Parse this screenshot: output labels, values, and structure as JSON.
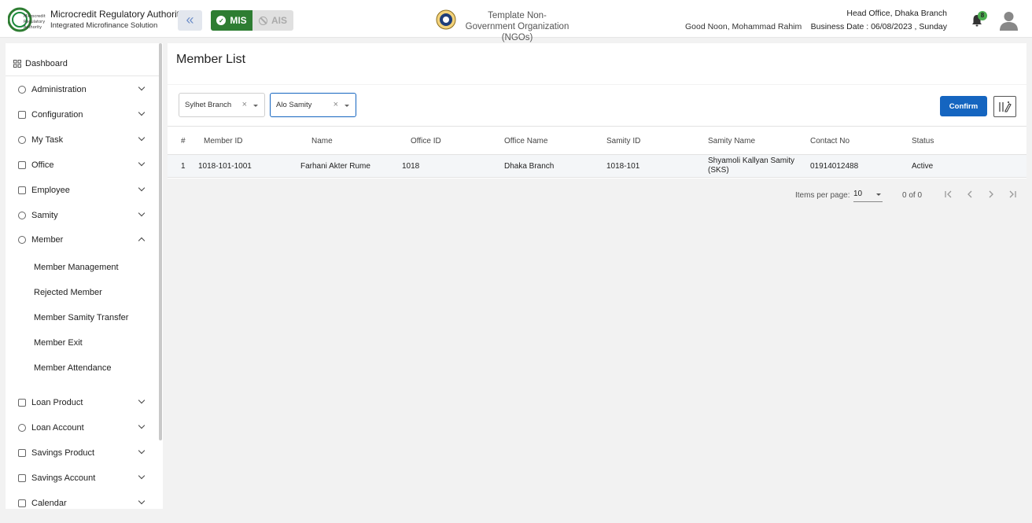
{
  "header": {
    "logo_text": "Microcredit Regulatory Authority",
    "org_name": "Microcredit Regulatory Authority",
    "org_subtitle": "Integrated Microfinance Solution",
    "mis_label": "MIS",
    "ais_label": "AIS",
    "ngo_title": "Template Non-Government Organization (NGOs)",
    "greeting": "Good Noon, Mohammad Rahim",
    "office": "Head Office, Dhaka Branch",
    "business_date": "Business Date : 06/08/2023 , Sunday",
    "notification_count": "8",
    "accent": "#2e7d32"
  },
  "sidebar": {
    "dashboard": "Dashboard",
    "items": [
      {
        "label": "Administration",
        "icon": "admin-icon"
      },
      {
        "label": "Configuration",
        "icon": "config-icon"
      },
      {
        "label": "My Task",
        "icon": "task-icon"
      },
      {
        "label": "Office",
        "icon": "office-icon"
      },
      {
        "label": "Employee",
        "icon": "employee-icon"
      },
      {
        "label": "Samity",
        "icon": "samity-icon"
      },
      {
        "label": "Member",
        "icon": "member-icon"
      }
    ],
    "member_sub": [
      "Member Management",
      "Rejected Member",
      "Member Samity Transfer",
      "Member Exit",
      "Member Attendance"
    ],
    "items_after": [
      {
        "label": "Loan Product",
        "icon": "loan-product-icon"
      },
      {
        "label": "Loan Account",
        "icon": "loan-account-icon"
      },
      {
        "label": "Savings Product",
        "icon": "savings-product-icon"
      },
      {
        "label": "Savings Account",
        "icon": "savings-account-icon"
      },
      {
        "label": "Calendar",
        "icon": "calendar-icon"
      }
    ]
  },
  "main": {
    "title": "Member List",
    "filters": {
      "branch": "Sylhet Branch",
      "samity": "Alo Samity",
      "clear": "×"
    },
    "confirm_label": "Confirm",
    "table": {
      "columns": [
        "#",
        "Member ID",
        "Name",
        "Office ID",
        "Office Name",
        "Samity ID",
        "Samity Name",
        "Contact No",
        "Status"
      ],
      "rows": [
        [
          "1",
          "1018-101-1001",
          "Farhani Akter Rume",
          "1018",
          "Dhaka Branch",
          "1018-101",
          "Shyamoli Kallyan Samity (SKS)",
          "01914012488",
          "Active"
        ]
      ]
    },
    "paginator": {
      "items_per_page_label": "Items per page:",
      "page_size": "10",
      "range": "0 of 0"
    }
  }
}
